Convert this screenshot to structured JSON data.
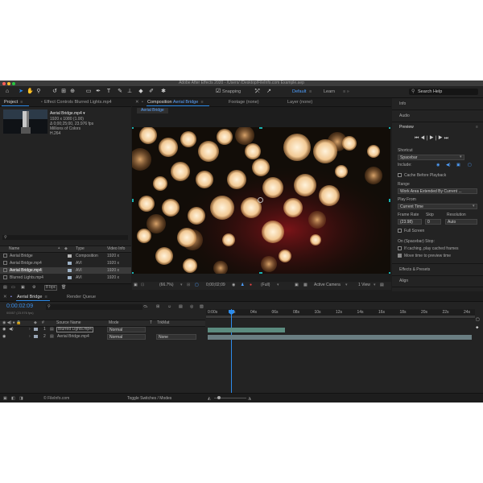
{
  "window": {
    "title": "Adobe After Effects 2020 - /Users/            /Desktop/FileInfo.com Example.aep"
  },
  "toolbar": {
    "snapping": "Snapping",
    "workspace_default": "Default",
    "workspace_learn": "Learn",
    "search_placeholder": "Search Help"
  },
  "project": {
    "tab_project": "Project",
    "tab_effect_controls": "Effect Controls Blurred Lights.mp4",
    "selected_name": "Aerial Bridge.mp4 ▾",
    "info_lines": [
      "1920 x 1080 (1.00)",
      "Δ 0;00;25;00, 23.976 fps",
      "Millions of Colors",
      "H.264"
    ],
    "columns": {
      "name": "Name",
      "type": "Type",
      "video_info": "Video Info"
    },
    "items": [
      {
        "name": "Aerial Bridge",
        "type": "Composition",
        "info": "1920 x",
        "color": "#b4b4b4"
      },
      {
        "name": "Aerial Bridge.mp4",
        "type": "AVI",
        "info": "1920 x",
        "color": "#9fb3c8"
      },
      {
        "name": "Aerial Bridge.mp4",
        "type": "AVI",
        "info": "1920 x",
        "color": "#9fb3c8"
      },
      {
        "name": "Blurred Lights.mp4",
        "type": "AVI",
        "info": "1920 x",
        "color": "#9fb3c8"
      }
    ],
    "bpc": "8 bpc"
  },
  "composition": {
    "tab_prefix": "Composition",
    "tab_name": "Aerial Bridge",
    "tab_footage": "Footage (none)",
    "tab_layer": "Layer (none)",
    "breadcrumb": "Aerial Bridge",
    "zoom": "(66.7%)",
    "timecode": "0;00;02;09",
    "resolution": "(Full)",
    "camera": "Active Camera",
    "views": "1 View"
  },
  "right_panel": {
    "info": "Info",
    "audio": "Audio",
    "preview": "Preview",
    "shortcut_label": "Shortcut",
    "shortcut_value": "Spacebar",
    "include": "Include:",
    "cache_before": "Cache Before Playback",
    "range": "Range",
    "range_value": "Work Area Extended By Current ...",
    "play_from": "Play From",
    "play_from_value": "Current Time",
    "frame_rate": "Frame Rate",
    "skip": "Skip",
    "resolution": "Resolution",
    "frame_rate_value": "(23.98)",
    "skip_value": "0",
    "resolution_value": "Auto",
    "full_screen": "Full Screen",
    "on_stop": "On (Spacebar) Stop:",
    "if_caching": "If caching, play cached frames",
    "move_time": "Move time to preview time",
    "effects_presets": "Effects & Presets",
    "align": "Align"
  },
  "timeline": {
    "tab_comp": "Aerial Bridge",
    "tab_render": "Render Queue",
    "current_time": "0:00:02:09",
    "frame_info": "00057 (23.976 fps)",
    "col_source": "Source Name",
    "col_mode": "Mode",
    "col_t": "T",
    "col_trkmat": "TrkMat",
    "layers": [
      {
        "num": "1",
        "name": "Blurred Lights.mp4",
        "mode": "Normal",
        "trkmat": "",
        "color": "#9aa6b6"
      },
      {
        "num": "2",
        "name": "Aerial Bridge.mp4",
        "mode": "Normal",
        "trkmat": "None",
        "color": "#9aa6b6"
      }
    ],
    "ruler": [
      "0:00s",
      "02s",
      "04s",
      "06s",
      "08s",
      "10s",
      "12s",
      "14s",
      "16s",
      "18s",
      "20s",
      "22s",
      "24s"
    ],
    "toggle": "Toggle Switches / Modes",
    "watermark": "© FileInfo.com"
  }
}
